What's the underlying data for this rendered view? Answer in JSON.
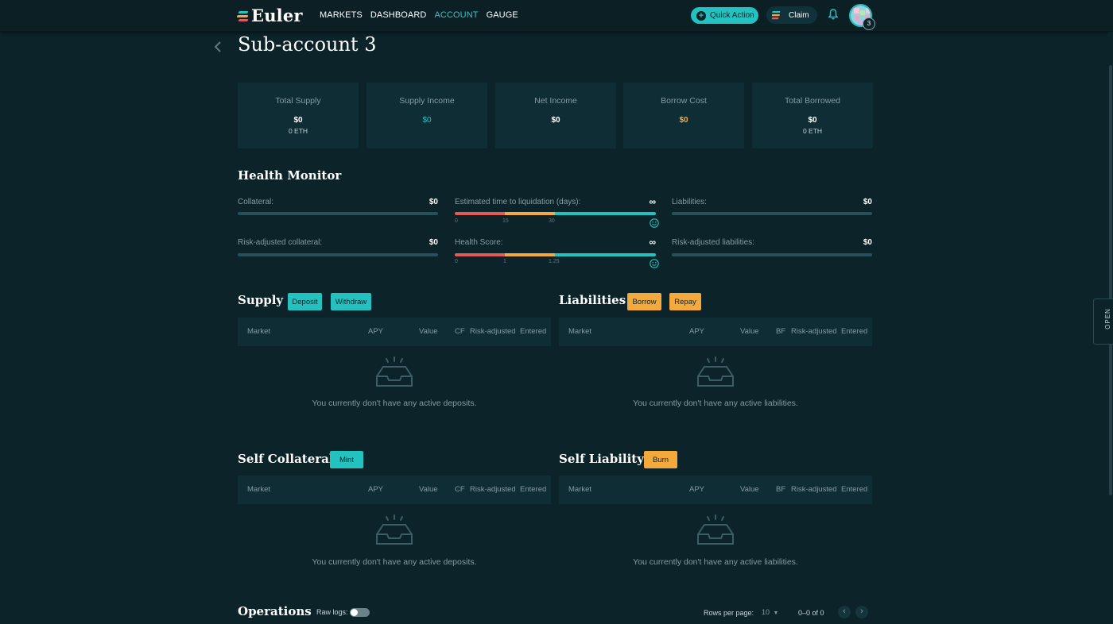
{
  "header": {
    "logo_text": "Euler",
    "nav": [
      {
        "label": "MARKETS",
        "active": false
      },
      {
        "label": "DASHBOARD",
        "active": false
      },
      {
        "label": "ACCOUNT",
        "active": true
      },
      {
        "label": "GAUGE",
        "active": false
      }
    ],
    "quick_action_label": "Quick Action",
    "claim_label": "Claim",
    "avatar_badge": "3"
  },
  "page": {
    "title": "Sub-account 3",
    "open_tab_label": "OPEN"
  },
  "stats": [
    {
      "label": "Total Supply",
      "value": "$0",
      "sub": "0 ETH",
      "color": "#ffffff"
    },
    {
      "label": "Supply Income",
      "value": "$0",
      "sub": "",
      "color": "#23c2c0"
    },
    {
      "label": "Net Income",
      "value": "$0",
      "sub": "",
      "color": "#ffffff"
    },
    {
      "label": "Borrow Cost",
      "value": "$0",
      "sub": "",
      "color": "#f4a93d"
    },
    {
      "label": "Total Borrowed",
      "value": "$0",
      "sub": "0 ETH",
      "color": "#ffffff"
    }
  ],
  "health": {
    "title": "Health Monitor",
    "collateral_label": "Collateral:",
    "collateral_value": "$0",
    "risk_collateral_label": "Risk-adjusted collateral:",
    "risk_collateral_value": "$0",
    "liquidation_label": "Estimated time to liquidation (days):",
    "liquidation_value": "∞",
    "liquidation_ticks": [
      "0",
      "15",
      "30"
    ],
    "health_score_label": "Health Score:",
    "health_score_value": "∞",
    "health_ticks": [
      "0",
      "1",
      "1.25"
    ],
    "liabilities_label": "Liabilities:",
    "liabilities_value": "$0",
    "risk_liabilities_label": "Risk-adjusted liabilities:",
    "risk_liabilities_value": "$0",
    "colors": {
      "red": "#e35a5a",
      "orange": "#f4a93d",
      "teal": "#23c2c0"
    }
  },
  "supply": {
    "title": "Supply",
    "deposit_label": "Deposit",
    "withdraw_label": "Withdraw",
    "columns": [
      "Market",
      "APY",
      "Value",
      "CF",
      "Risk-adjusted",
      "Entered"
    ],
    "empty_text": "You currently don't have any active deposits."
  },
  "liabilities": {
    "title": "Liabilities",
    "borrow_label": "Borrow",
    "repay_label": "Repay",
    "columns": [
      "Market",
      "APY",
      "Value",
      "BF",
      "Risk-adjusted",
      "Entered"
    ],
    "empty_text": "You currently don't have any active liabilities."
  },
  "self_collateral": {
    "title": "Self Collateral",
    "mint_label": "Mint",
    "columns": [
      "Market",
      "APY",
      "Value",
      "CF",
      "Risk-adjusted",
      "Entered"
    ],
    "empty_text": "You currently don't have any active deposits."
  },
  "self_liability": {
    "title": "Self Liability",
    "burn_label": "Burn",
    "columns": [
      "Market",
      "APY",
      "Value",
      "BF",
      "Risk-adjusted",
      "Entered"
    ],
    "empty_text": "You currently don't have any active liabilities."
  },
  "operations": {
    "title": "Operations",
    "raw_logs_label": "Raw logs:",
    "raw_logs_enabled": false,
    "rows_per_page_label": "Rows per page:",
    "rows_per_page_value": "10",
    "range_label": "0–0 of 0"
  }
}
